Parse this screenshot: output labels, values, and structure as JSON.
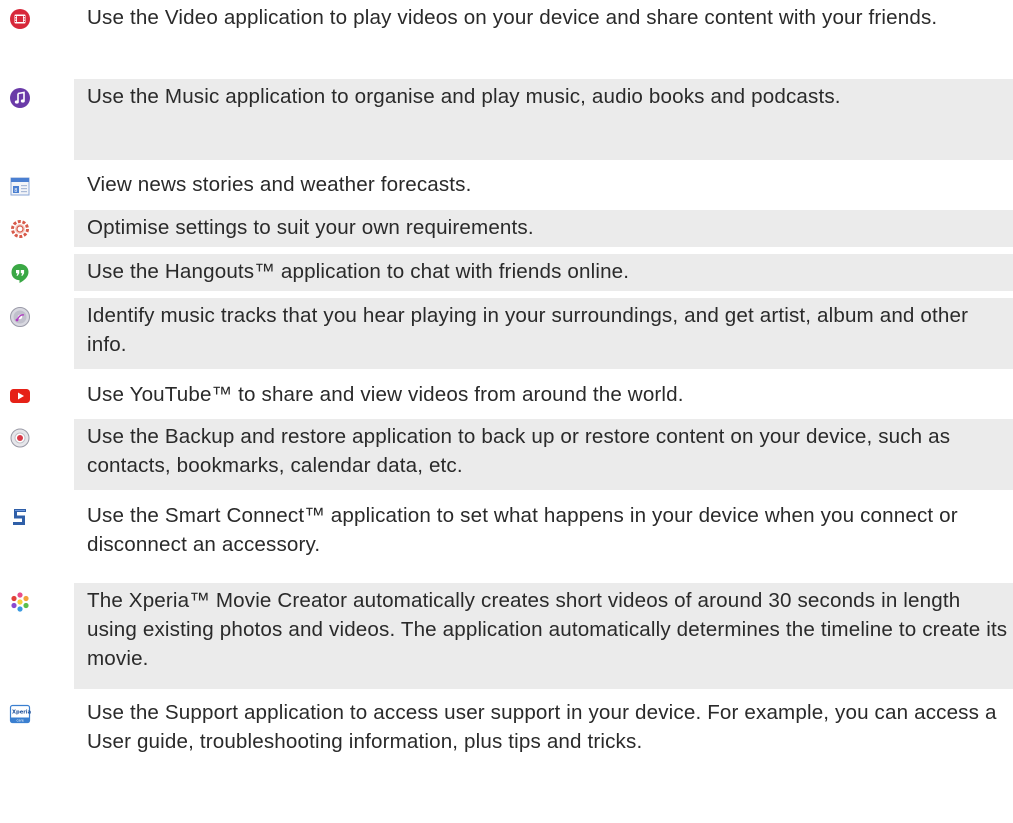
{
  "apps": [
    {
      "icon": "video-icon",
      "description": "Use the Video application to play videos on your device and share content with your friends."
    },
    {
      "icon": "music-icon",
      "description": "Use the Music application to organise and play music, audio books and podcasts."
    },
    {
      "icon": "news-weather-icon",
      "description": "View news stories and weather forecasts."
    },
    {
      "icon": "settings-icon",
      "description": "Optimise settings to suit your own requirements."
    },
    {
      "icon": "hangouts-icon",
      "description": "Use the Hangouts™ application to chat with friends online."
    },
    {
      "icon": "trackid-icon",
      "description": "Identify music tracks that you hear playing in your surroundings, and get artist, album and other info."
    },
    {
      "icon": "youtube-icon",
      "description": "Use YouTube™ to share and view videos from around the world."
    },
    {
      "icon": "backup-restore-icon",
      "description": "Use the Backup and restore application to back up or restore content on your device, such as contacts, bookmarks, calendar data, etc."
    },
    {
      "icon": "smart-connect-icon",
      "description": "Use the Smart Connect™ application to set what happens in your device when you connect or disconnect an accessory."
    },
    {
      "icon": "movie-creator-icon",
      "description": "The Xperia™ Movie Creator automatically creates short videos of around 30 seconds in length using existing photos and videos. The application automatically determines the timeline to create its movie."
    },
    {
      "icon": "support-icon",
      "description": "Use the Support application to access user support in your device. For example, you can access a User guide, troubleshooting information, plus tips and tricks.",
      "icon_text": "Xperia care"
    }
  ],
  "colors": {
    "row_shade": "#ebebeb",
    "text": "#2a2a2a",
    "video_red": "#d7283a",
    "music_purple": "#6a3aa8",
    "hangouts_green": "#3aa845",
    "youtube_red": "#e62117"
  }
}
